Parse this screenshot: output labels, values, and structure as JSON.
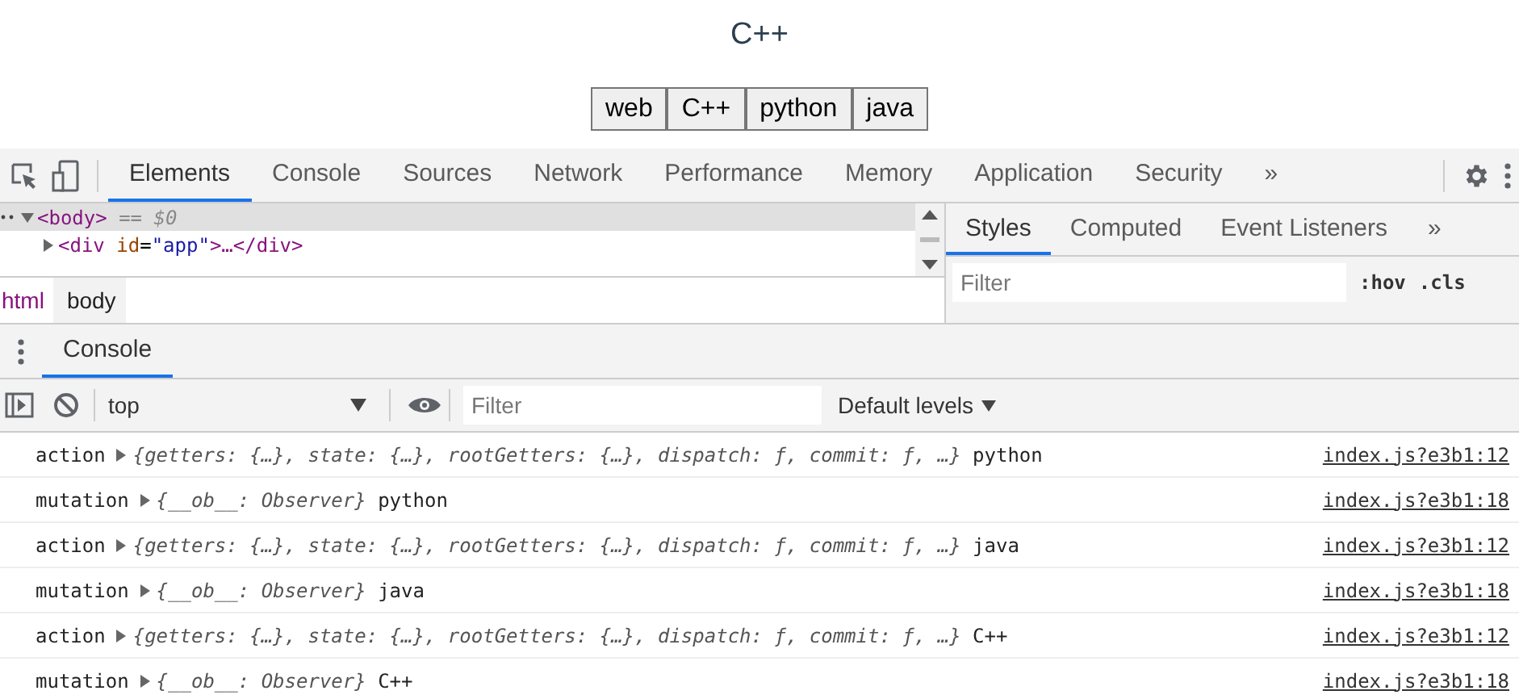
{
  "page": {
    "heading": "C++",
    "buttons": [
      "web",
      "C++",
      "python",
      "java"
    ]
  },
  "devtools": {
    "tabs": [
      {
        "label": "Elements",
        "selected": true
      },
      {
        "label": "Console",
        "selected": false
      },
      {
        "label": "Sources",
        "selected": false
      },
      {
        "label": "Network",
        "selected": false
      },
      {
        "label": "Performance",
        "selected": false
      },
      {
        "label": "Memory",
        "selected": false
      },
      {
        "label": "Application",
        "selected": false
      },
      {
        "label": "Security",
        "selected": false
      }
    ],
    "more": "»",
    "dom": [
      {
        "kind": "selected",
        "tag": "<body>",
        "suffix": "== $0"
      },
      {
        "kind": "node",
        "open": "<div",
        "attr": "id",
        "eq": "=",
        "value": "\"app\"",
        "rest": ">…</div>"
      }
    ],
    "breadcrumbs": [
      {
        "label": "html",
        "selected": false
      },
      {
        "label": "body",
        "selected": true
      }
    ],
    "side_tabs": [
      {
        "label": "Styles",
        "selected": true
      },
      {
        "label": "Computed",
        "selected": false
      },
      {
        "label": "Event Listeners",
        "selected": false
      }
    ],
    "side_more": "»",
    "styles_filter": {
      "placeholder": "Filter"
    },
    "hov": ":hov",
    "cls": ".cls",
    "drawer_tab": "Console",
    "context": "top",
    "console_filter": {
      "placeholder": "Filter"
    },
    "levels": "Default levels",
    "messages": [
      {
        "label": "action",
        "object": "{getters: {…}, state: {…}, rootGetters: {…}, dispatch: ƒ, commit: ƒ, …}",
        "value": "python",
        "source": "index.js?e3b1:12"
      },
      {
        "label": "mutation",
        "object": "{__ob__: Observer}",
        "value": "python",
        "source": "index.js?e3b1:18"
      },
      {
        "label": "action",
        "object": "{getters: {…}, state: {…}, rootGetters: {…}, dispatch: ƒ, commit: ƒ, …}",
        "value": "java",
        "source": "index.js?e3b1:12"
      },
      {
        "label": "mutation",
        "object": "{__ob__: Observer}",
        "value": "java",
        "source": "index.js?e3b1:18"
      },
      {
        "label": "action",
        "object": "{getters: {…}, state: {…}, rootGetters: {…}, dispatch: ƒ, commit: ƒ, …}",
        "value": "C++",
        "source": "index.js?e3b1:12"
      },
      {
        "label": "mutation",
        "object": "{__ob__: Observer}",
        "value": "C++",
        "source": "index.js?e3b1:18"
      }
    ]
  }
}
